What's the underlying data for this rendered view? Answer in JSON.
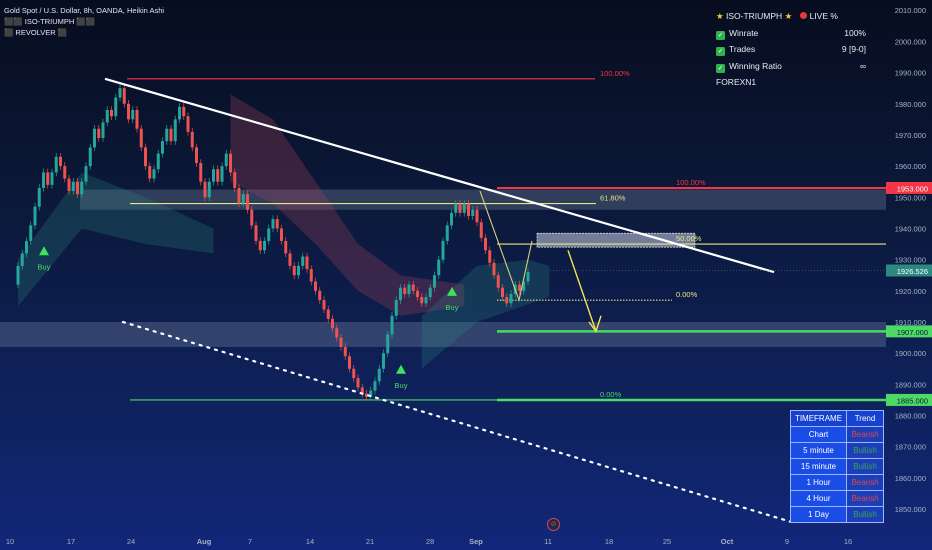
{
  "header": {
    "symbol_line": "Gold Spot / U.S. Dollar, 8h, OANDA, Heikin Ashi",
    "indicator_1": "⬛⬛ ISO-TRIUMPH ⬛⬛",
    "indicator_2": "⬛ REVOLVER ⬛"
  },
  "stats_panel": {
    "title": "ISO-TRIUMPH",
    "live_label": "LIVE %",
    "rows": [
      {
        "label": "Winrate",
        "value": "100%"
      },
      {
        "label": "Trades",
        "value": "9 [9-0]"
      },
      {
        "label": "Winning Ratio",
        "value": "∞"
      }
    ],
    "footer": "FOREXN1"
  },
  "timeframe_table": {
    "header": [
      "TIMEFRAME",
      "Trend"
    ],
    "rows": [
      {
        "timeframe": "Chart",
        "trend": "Bearish",
        "status": "bear"
      },
      {
        "timeframe": "5 minute",
        "trend": "Bullish",
        "status": "bull"
      },
      {
        "timeframe": "15 minute",
        "trend": "Bullish",
        "status": "bull"
      },
      {
        "timeframe": "1 Hour",
        "trend": "Bearish",
        "status": "bear"
      },
      {
        "timeframe": "4 Hour",
        "trend": "Bearish",
        "status": "bear"
      },
      {
        "timeframe": "1 Day",
        "trend": "Bullish",
        "status": "bull"
      }
    ]
  },
  "colors": {
    "bull_candle": "#26a69a",
    "bear_candle": "#ef5350",
    "resistance": "#f23645",
    "support": "#4cd964",
    "fib": "#e6e680",
    "price_tag": "#2a8a7e",
    "trendline": "#ffffff"
  },
  "chart_data": {
    "type": "candlestick",
    "symbol": "Gold Spot / U.S. Dollar",
    "interval": "8h",
    "price_axis": {
      "ticks": [
        2010,
        2000,
        1990,
        1980,
        1970,
        1960,
        1950,
        1940,
        1930,
        1920,
        1910,
        1900,
        1890,
        1880,
        1870,
        1860,
        1850
      ],
      "ylim": [
        1842,
        2012
      ]
    },
    "time_axis": {
      "labels": [
        "10",
        "17",
        "24",
        "Aug",
        "7",
        "14",
        "21",
        "28",
        "Sep",
        "11",
        "18",
        "25",
        "Oct",
        "9",
        "16"
      ]
    },
    "current_price": "1926.526",
    "price_tags": [
      {
        "text": "1953.000",
        "kind": "resistance"
      },
      {
        "text": "1907.000",
        "kind": "support"
      },
      {
        "text": "1885.000",
        "kind": "support"
      }
    ],
    "levels": [
      {
        "label": "100.00%",
        "price": 1988,
        "kind": "resistance"
      },
      {
        "label": "100.00%",
        "price": 1953,
        "kind": "resistance"
      },
      {
        "label": "61.80%",
        "price": 1948,
        "kind": "fib"
      },
      {
        "label": "61.80%",
        "price": 1941,
        "kind": "fib"
      },
      {
        "label": "50.00%",
        "price": 1935,
        "kind": "fib"
      },
      {
        "label": "0.00%",
        "price": 1917,
        "kind": "fib"
      },
      {
        "label": "0.00%",
        "price": 1885,
        "kind": "support"
      }
    ],
    "signals": [
      {
        "label": "Buy",
        "date": "Jul 11",
        "price": 1933
      },
      {
        "label": "Buy",
        "date": "Aug 21",
        "price": 1895
      },
      {
        "label": "Buy",
        "date": "Aug 31",
        "price": 1920
      }
    ],
    "candles": [
      {
        "o": 1922,
        "c": 1928
      },
      {
        "o": 1928,
        "c": 1932
      },
      {
        "o": 1932,
        "c": 1936
      },
      {
        "o": 1936,
        "c": 1941
      },
      {
        "o": 1941,
        "c": 1947
      },
      {
        "o": 1947,
        "c": 1953
      },
      {
        "o": 1953,
        "c": 1958
      },
      {
        "o": 1958,
        "c": 1954
      },
      {
        "o": 1954,
        "c": 1958
      },
      {
        "o": 1958,
        "c": 1963
      },
      {
        "o": 1963,
        "c": 1960
      },
      {
        "o": 1960,
        "c": 1956
      },
      {
        "o": 1956,
        "c": 1952
      },
      {
        "o": 1952,
        "c": 1955
      },
      {
        "o": 1955,
        "c": 1951
      },
      {
        "o": 1951,
        "c": 1955
      },
      {
        "o": 1955,
        "c": 1960
      },
      {
        "o": 1960,
        "c": 1966
      },
      {
        "o": 1966,
        "c": 1972
      },
      {
        "o": 1972,
        "c": 1969
      },
      {
        "o": 1969,
        "c": 1974
      },
      {
        "o": 1974,
        "c": 1978
      },
      {
        "o": 1978,
        "c": 1976
      },
      {
        "o": 1976,
        "c": 1982
      },
      {
        "o": 1982,
        "c": 1985
      },
      {
        "o": 1985,
        "c": 1980
      },
      {
        "o": 1980,
        "c": 1975
      },
      {
        "o": 1975,
        "c": 1978
      },
      {
        "o": 1978,
        "c": 1972
      },
      {
        "o": 1972,
        "c": 1966
      },
      {
        "o": 1966,
        "c": 1960
      },
      {
        "o": 1960,
        "c": 1956
      },
      {
        "o": 1956,
        "c": 1959
      },
      {
        "o": 1959,
        "c": 1964
      },
      {
        "o": 1964,
        "c": 1968
      },
      {
        "o": 1968,
        "c": 1972
      },
      {
        "o": 1972,
        "c": 1968
      },
      {
        "o": 1968,
        "c": 1975
      },
      {
        "o": 1975,
        "c": 1979
      },
      {
        "o": 1979,
        "c": 1976
      },
      {
        "o": 1976,
        "c": 1971
      },
      {
        "o": 1971,
        "c": 1966
      },
      {
        "o": 1966,
        "c": 1961
      },
      {
        "o": 1961,
        "c": 1955
      },
      {
        "o": 1955,
        "c": 1950
      },
      {
        "o": 1950,
        "c": 1955
      },
      {
        "o": 1955,
        "c": 1959
      },
      {
        "o": 1959,
        "c": 1955
      },
      {
        "o": 1955,
        "c": 1960
      },
      {
        "o": 1960,
        "c": 1964
      },
      {
        "o": 1964,
        "c": 1958
      },
      {
        "o": 1958,
        "c": 1953
      },
      {
        "o": 1953,
        "c": 1948
      },
      {
        "o": 1948,
        "c": 1951
      },
      {
        "o": 1951,
        "c": 1946
      },
      {
        "o": 1946,
        "c": 1941
      },
      {
        "o": 1941,
        "c": 1936
      },
      {
        "o": 1936,
        "c": 1933
      },
      {
        "o": 1933,
        "c": 1936
      },
      {
        "o": 1936,
        "c": 1940
      },
      {
        "o": 1940,
        "c": 1943
      },
      {
        "o": 1943,
        "c": 1940
      },
      {
        "o": 1940,
        "c": 1936
      },
      {
        "o": 1936,
        "c": 1932
      },
      {
        "o": 1932,
        "c": 1928
      },
      {
        "o": 1928,
        "c": 1925
      },
      {
        "o": 1925,
        "c": 1928
      },
      {
        "o": 1928,
        "c": 1931
      },
      {
        "o": 1931,
        "c": 1927
      },
      {
        "o": 1927,
        "c": 1923
      },
      {
        "o": 1923,
        "c": 1920
      },
      {
        "o": 1920,
        "c": 1917
      },
      {
        "o": 1917,
        "c": 1914
      },
      {
        "o": 1914,
        "c": 1911
      },
      {
        "o": 1911,
        "c": 1908
      },
      {
        "o": 1908,
        "c": 1905
      },
      {
        "o": 1905,
        "c": 1902
      },
      {
        "o": 1902,
        "c": 1899
      },
      {
        "o": 1899,
        "c": 1895
      },
      {
        "o": 1895,
        "c": 1892
      },
      {
        "o": 1892,
        "c": 1889
      },
      {
        "o": 1889,
        "c": 1887
      },
      {
        "o": 1887,
        "c": 1886
      },
      {
        "o": 1886,
        "c": 1888
      },
      {
        "o": 1888,
        "c": 1891
      },
      {
        "o": 1891,
        "c": 1895
      },
      {
        "o": 1895,
        "c": 1900
      },
      {
        "o": 1900,
        "c": 1906
      },
      {
        "o": 1906,
        "c": 1912
      },
      {
        "o": 1912,
        "c": 1917
      },
      {
        "o": 1917,
        "c": 1921
      },
      {
        "o": 1921,
        "c": 1919
      },
      {
        "o": 1919,
        "c": 1922
      },
      {
        "o": 1922,
        "c": 1920
      },
      {
        "o": 1920,
        "c": 1918
      },
      {
        "o": 1918,
        "c": 1916
      },
      {
        "o": 1916,
        "c": 1918
      },
      {
        "o": 1918,
        "c": 1921
      },
      {
        "o": 1921,
        "c": 1925
      },
      {
        "o": 1925,
        "c": 1930
      },
      {
        "o": 1930,
        "c": 1936
      },
      {
        "o": 1936,
        "c": 1941
      },
      {
        "o": 1941,
        "c": 1945
      },
      {
        "o": 1945,
        "c": 1948
      },
      {
        "o": 1948,
        "c": 1945
      },
      {
        "o": 1945,
        "c": 1948
      },
      {
        "o": 1948,
        "c": 1944
      },
      {
        "o": 1944,
        "c": 1946
      },
      {
        "o": 1946,
        "c": 1942
      },
      {
        "o": 1942,
        "c": 1937
      },
      {
        "o": 1937,
        "c": 1933
      },
      {
        "o": 1933,
        "c": 1929
      },
      {
        "o": 1929,
        "c": 1925
      },
      {
        "o": 1925,
        "c": 1921
      },
      {
        "o": 1921,
        "c": 1918
      },
      {
        "o": 1918,
        "c": 1916
      },
      {
        "o": 1916,
        "c": 1919
      },
      {
        "o": 1919,
        "c": 1922
      },
      {
        "o": 1922,
        "c": 1920
      },
      {
        "o": 1920,
        "c": 1923
      },
      {
        "o": 1923,
        "c": 1926
      }
    ]
  }
}
